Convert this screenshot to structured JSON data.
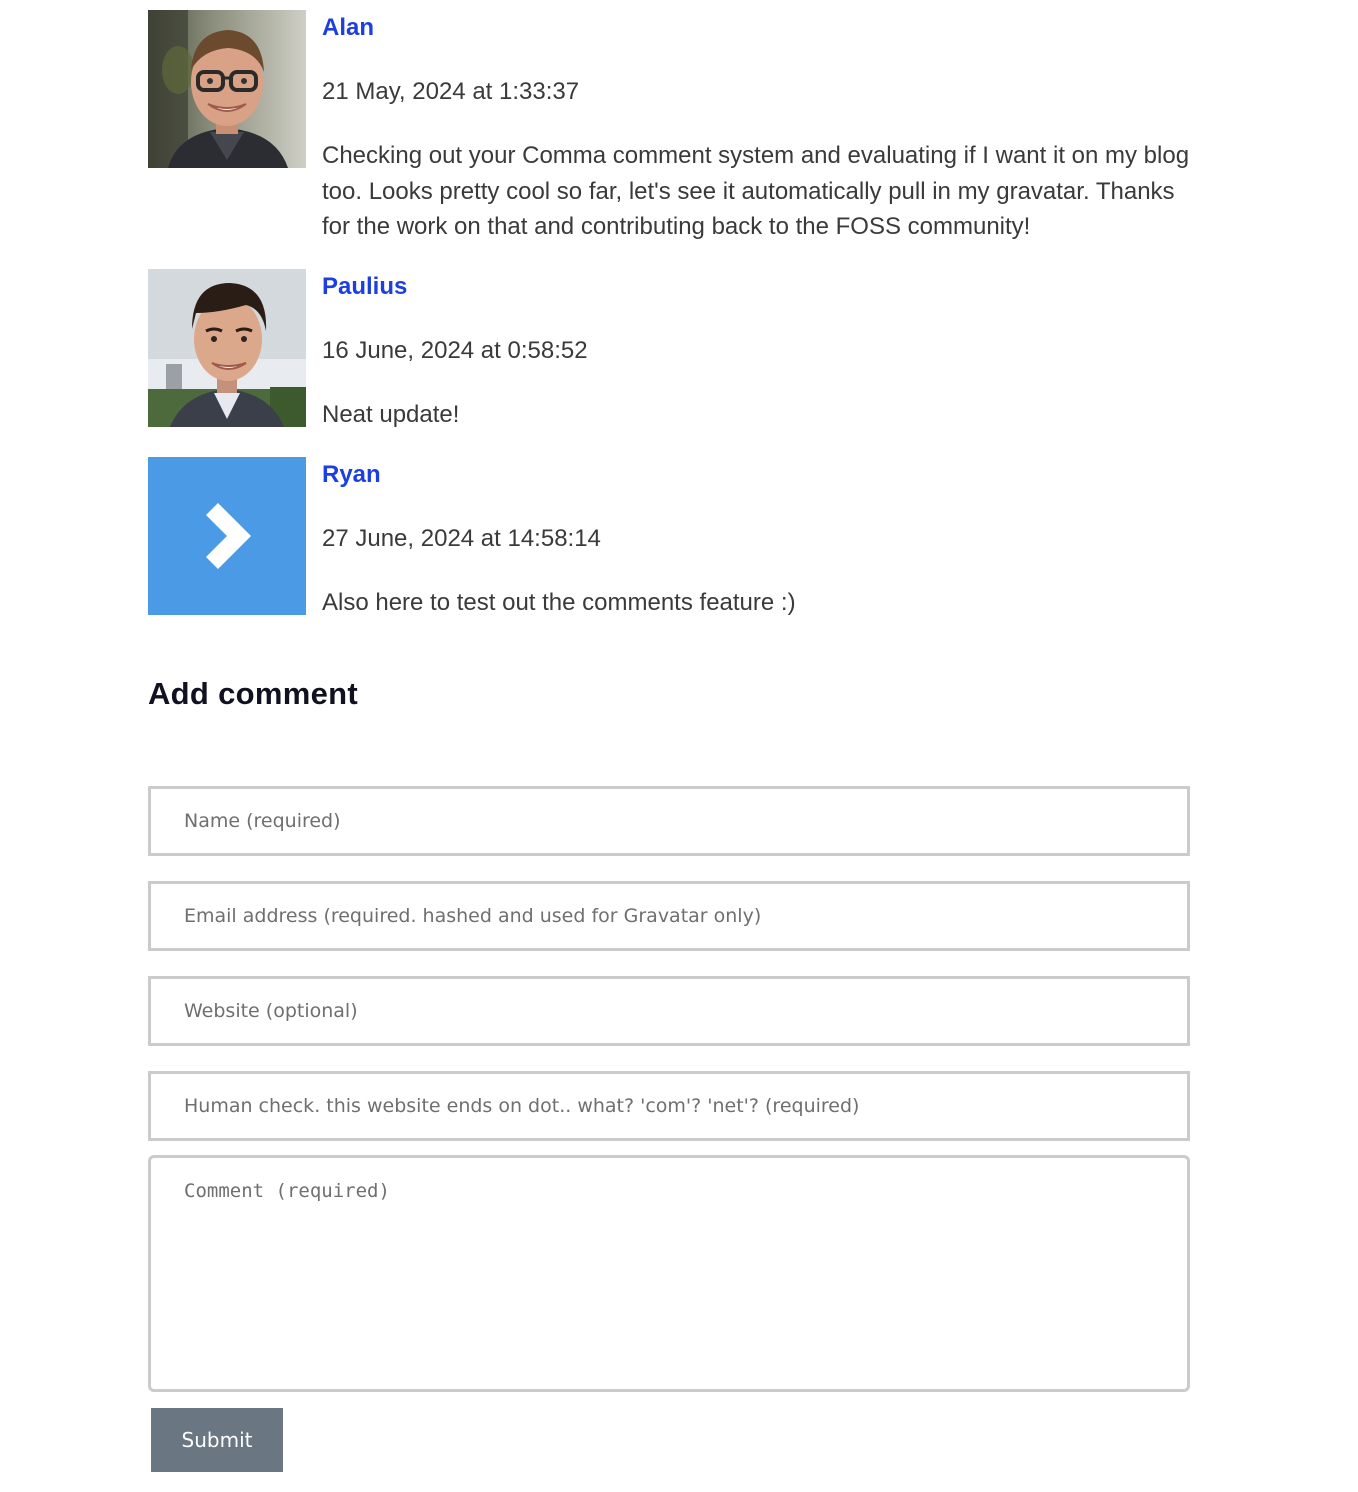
{
  "comments": [
    {
      "author": "Alan",
      "date": "21 May, 2024 at 1:33:37",
      "text": "Checking out your Comma comment system and evaluating if I want it on my blog too. Looks pretty cool so far, let's see it automatically pull in my gravatar. Thanks for the work on that and contributing back to the FOSS community!",
      "avatar": "photo-avatar"
    },
    {
      "author": "Paulius",
      "date": "16 June, 2024 at 0:58:52",
      "text": "Neat update!",
      "avatar": "photo-avatar"
    },
    {
      "author": "Ryan",
      "date": "27 June, 2024 at 14:58:14",
      "text": "Also here to test out the comments feature :)",
      "avatar": "chevron-right-icon",
      "avatar_color": "#4a9ae6"
    }
  ],
  "form": {
    "heading": "Add comment",
    "name_placeholder": "Name (required)",
    "email_placeholder": "Email address (required. hashed and used for Gravatar only)",
    "website_placeholder": "Website (optional)",
    "human_check_placeholder": "Human check. this website ends on dot.. what? 'com'? 'net'? (required)",
    "comment_placeholder": "Comment (required)",
    "submit_label": "Submit"
  },
  "colors": {
    "author_link": "#1e3fe0",
    "submit_bg": "#6b7683",
    "field_border": "#cbcbcb"
  }
}
